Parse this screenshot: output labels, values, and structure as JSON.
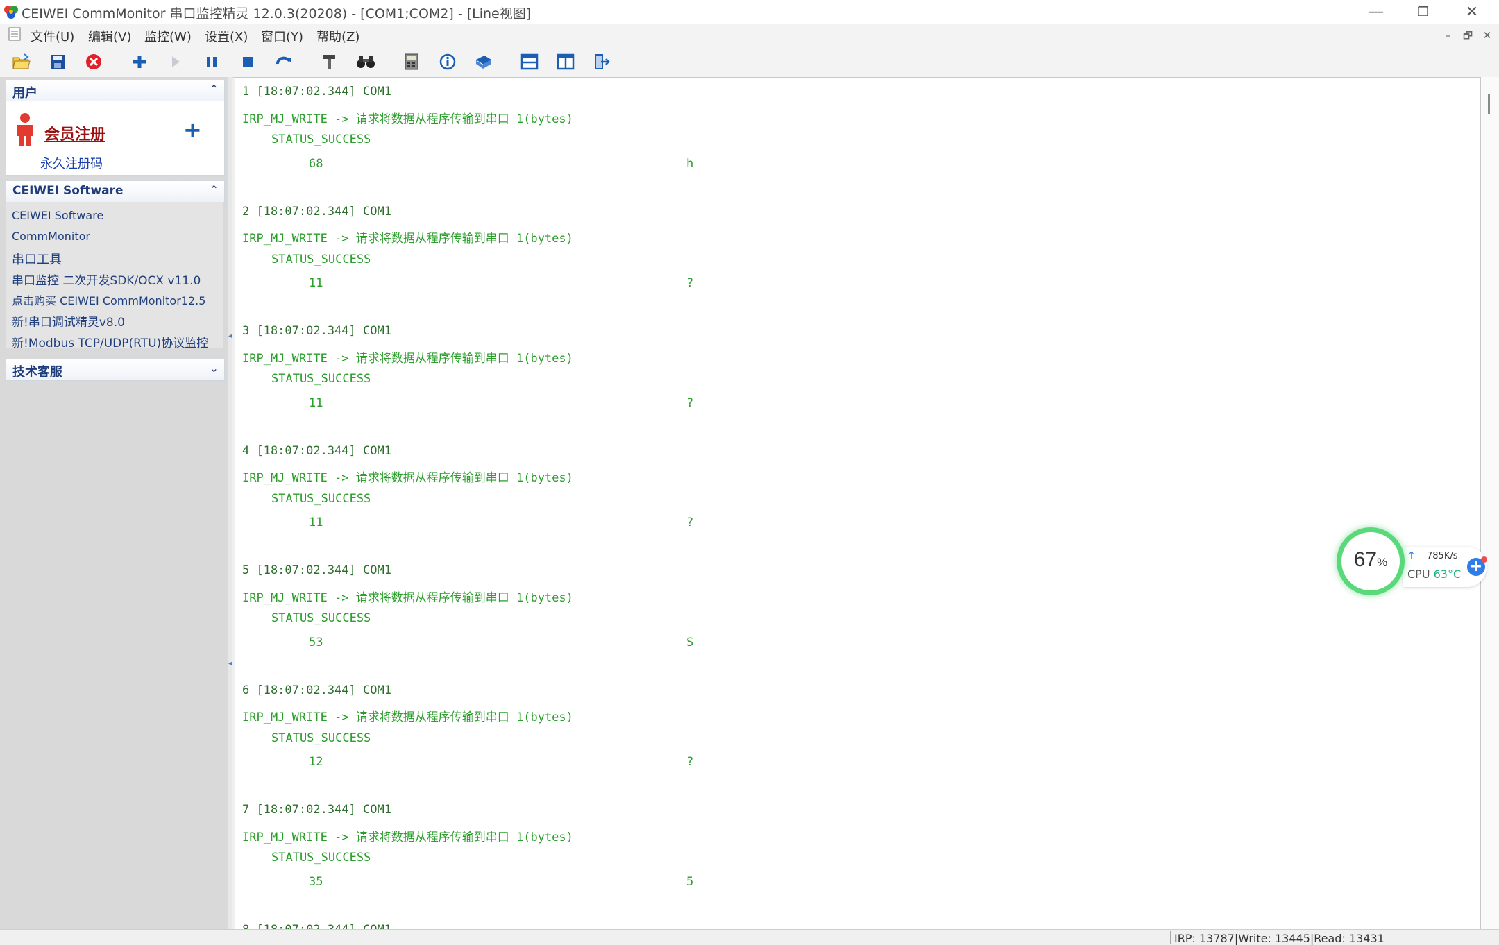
{
  "window": {
    "title": "CEIWEI CommMonitor 串口监控精灵 12.0.3(20208) - [COM1;COM2] - [Line视图]",
    "controls": {
      "minimize": "—",
      "restore": "❐",
      "close": "✕"
    }
  },
  "menu": {
    "items": [
      "文件(U)",
      "编辑(V)",
      "监控(W)",
      "设置(X)",
      "窗口(Y)",
      "帮助(Z)"
    ],
    "mdi_controls": {
      "minimize": "–",
      "restore": "🗗",
      "close": "✕"
    }
  },
  "toolbar": {
    "icons": [
      "open-folder-icon",
      "save-icon",
      "close-red-icon",
      "add-icon",
      "play-icon",
      "pause-icon",
      "stop-icon",
      "refresh-icon",
      "hammer-icon",
      "binoculars-icon",
      "calculator-icon",
      "info-icon",
      "book-icon",
      "split-horizontal-icon",
      "split-vertical-icon",
      "exit-icon"
    ],
    "accent": "#1a5fb4"
  },
  "sidebar": {
    "user_panel": {
      "title": "用户",
      "chevron": "⌃",
      "register_label": "会员注册",
      "register_add": "+",
      "permanent_code_label": "永久注册码"
    },
    "software_panel": {
      "title": "CEIWEI Software",
      "chevron": "⌃",
      "links": [
        "CEIWEI Software",
        "CommMonitor",
        "串口工具",
        "串口监控 二次开发SDK/OCX v11.0",
        "点击购买 CEIWEI CommMonitor12.5",
        "新!串口调试精灵v8.0",
        "新!Modbus TCP/UDP(RTU)协议监控"
      ]
    },
    "support_panel": {
      "title": "技术客服",
      "chevron": "⌄"
    }
  },
  "log": {
    "entries": [
      {
        "header": "1 [18:07:02.344] COM1",
        "op": "IRP_MJ_WRITE -> 请求将数据从程序传输到串口 1(bytes)",
        "status": "STATUS_SUCCESS",
        "hex": "68",
        "ascii": "h"
      },
      {
        "header": "2 [18:07:02.344] COM1",
        "op": "IRP_MJ_WRITE -> 请求将数据从程序传输到串口 1(bytes)",
        "status": "STATUS_SUCCESS",
        "hex": "11",
        "ascii": "?"
      },
      {
        "header": "3 [18:07:02.344] COM1",
        "op": "IRP_MJ_WRITE -> 请求将数据从程序传输到串口 1(bytes)",
        "status": "STATUS_SUCCESS",
        "hex": "11",
        "ascii": "?"
      },
      {
        "header": "4 [18:07:02.344] COM1",
        "op": "IRP_MJ_WRITE -> 请求将数据从程序传输到串口 1(bytes)",
        "status": "STATUS_SUCCESS",
        "hex": "11",
        "ascii": "?"
      },
      {
        "header": "5 [18:07:02.344] COM1",
        "op": "IRP_MJ_WRITE -> 请求将数据从程序传输到串口 1(bytes)",
        "status": "STATUS_SUCCESS",
        "hex": "53",
        "ascii": "S"
      },
      {
        "header": "6 [18:07:02.344] COM1",
        "op": "IRP_MJ_WRITE -> 请求将数据从程序传输到串口 1(bytes)",
        "status": "STATUS_SUCCESS",
        "hex": "12",
        "ascii": "?"
      },
      {
        "header": "7 [18:07:02.344] COM1",
        "op": "IRP_MJ_WRITE -> 请求将数据从程序传输到串口 1(bytes)",
        "status": "STATUS_SUCCESS",
        "hex": "35",
        "ascii": "5"
      }
    ],
    "partial_header": "8 [18:07:02.344] COM1",
    "text_color": "#2a9d2a"
  },
  "perf_widget": {
    "percent": "67",
    "percent_unit": "%",
    "net_speed": "785K/s",
    "cpu_label": "CPU",
    "cpu_temp": "63°C",
    "ring_color": "#5ad97a"
  },
  "statusbar": {
    "text": "IRP: 13787|Write: 13445|Read: 13431"
  }
}
